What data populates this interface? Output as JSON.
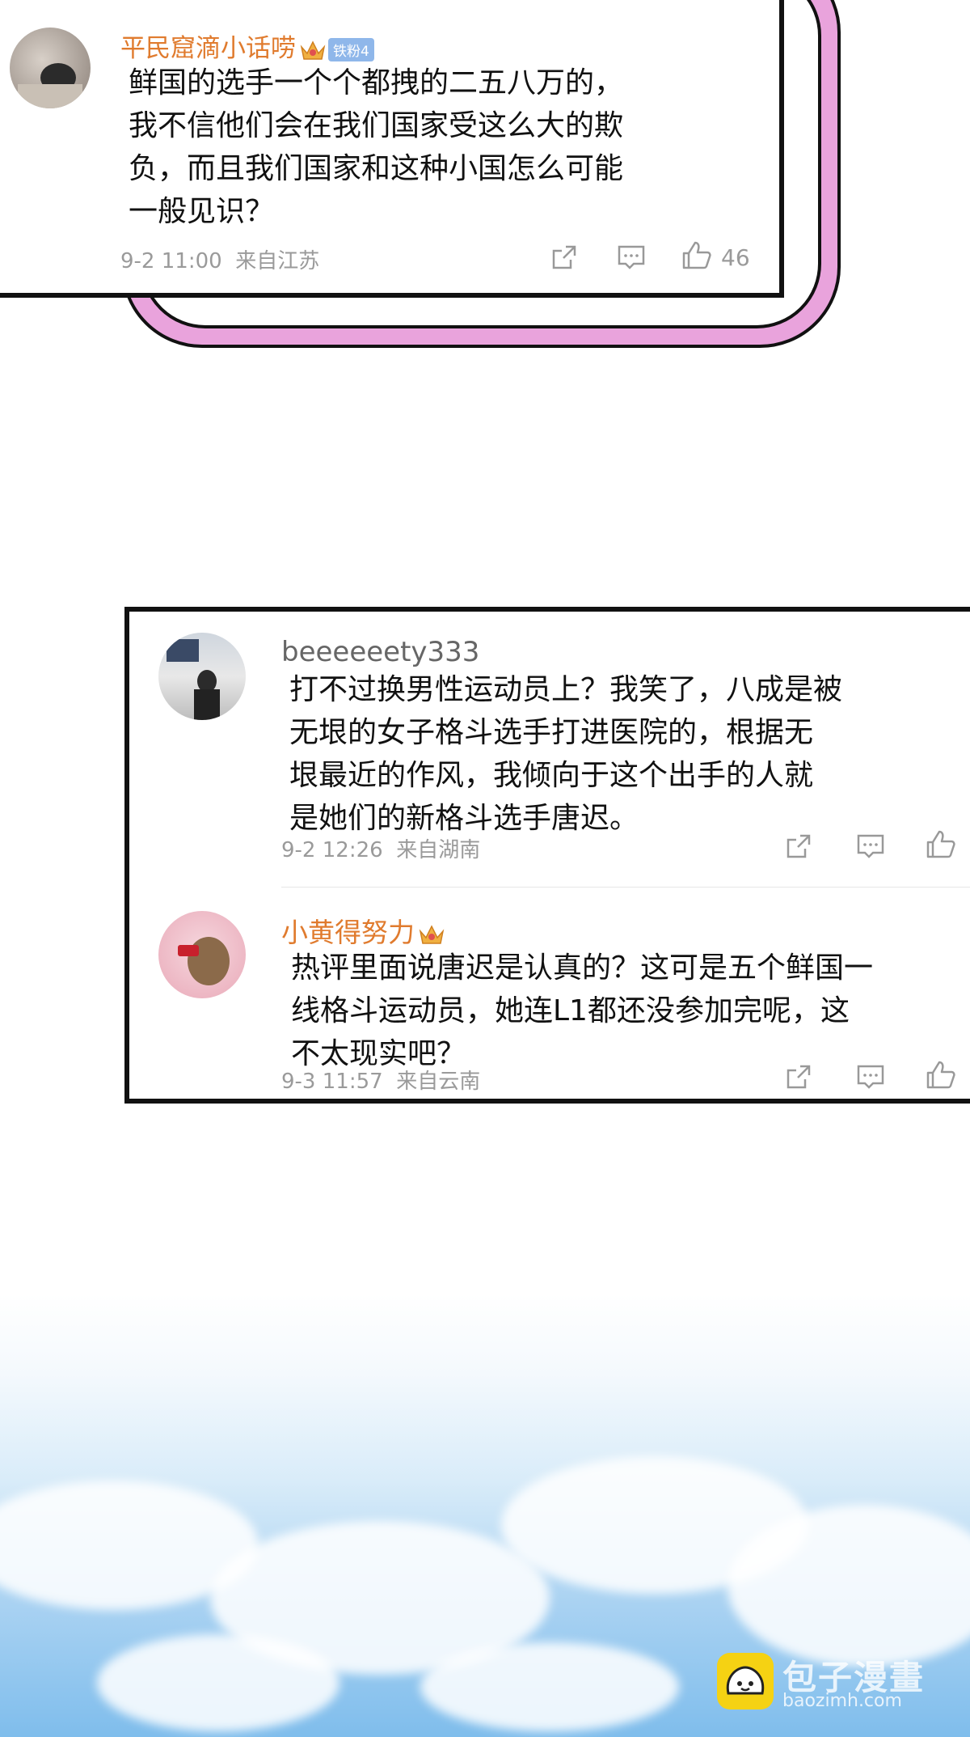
{
  "comments": [
    {
      "username": "平民窟滴小话唠",
      "fan_badge": "铁粉4",
      "text_lines": [
        "鲜国的选手一个个都拽的二五八万的，",
        "我不信他们会在我们国家受这么大的欺",
        "负，而且我们国家和这种小国怎么可能",
        "一般见识？"
      ],
      "time": "9-2 11:00",
      "location": "来自江苏",
      "likes": "46"
    },
    {
      "username": "beeeeeety333",
      "text_lines": [
        "打不过换男性运动员上？我笑了，八成是被",
        "无垠的女子格斗选手打进医院的，根据无",
        "垠最近的作风，我倾向于这个出手的人就",
        "是她们的新格斗选手唐迟。"
      ],
      "time": "9-2 12:26",
      "location": "来自湖南"
    },
    {
      "username": "小黄得努力",
      "text_lines": [
        "热评里面说唐迟是认真的？这可是五个鲜国一",
        "线格斗运动员，她连L1都还没参加完呢，这",
        "不太现实吧？"
      ],
      "time": "9-3 11:57",
      "location": "来自云南"
    }
  ],
  "watermark": {
    "title": "包子漫畫",
    "url": "baozimh.com"
  },
  "colors": {
    "frame_pink": "#e9a3dc",
    "username_orange": "#e07b2e",
    "sky_blue": "#7fbdec"
  },
  "icons": [
    "share-icon",
    "comment-icon",
    "like-icon",
    "crown-icon"
  ]
}
